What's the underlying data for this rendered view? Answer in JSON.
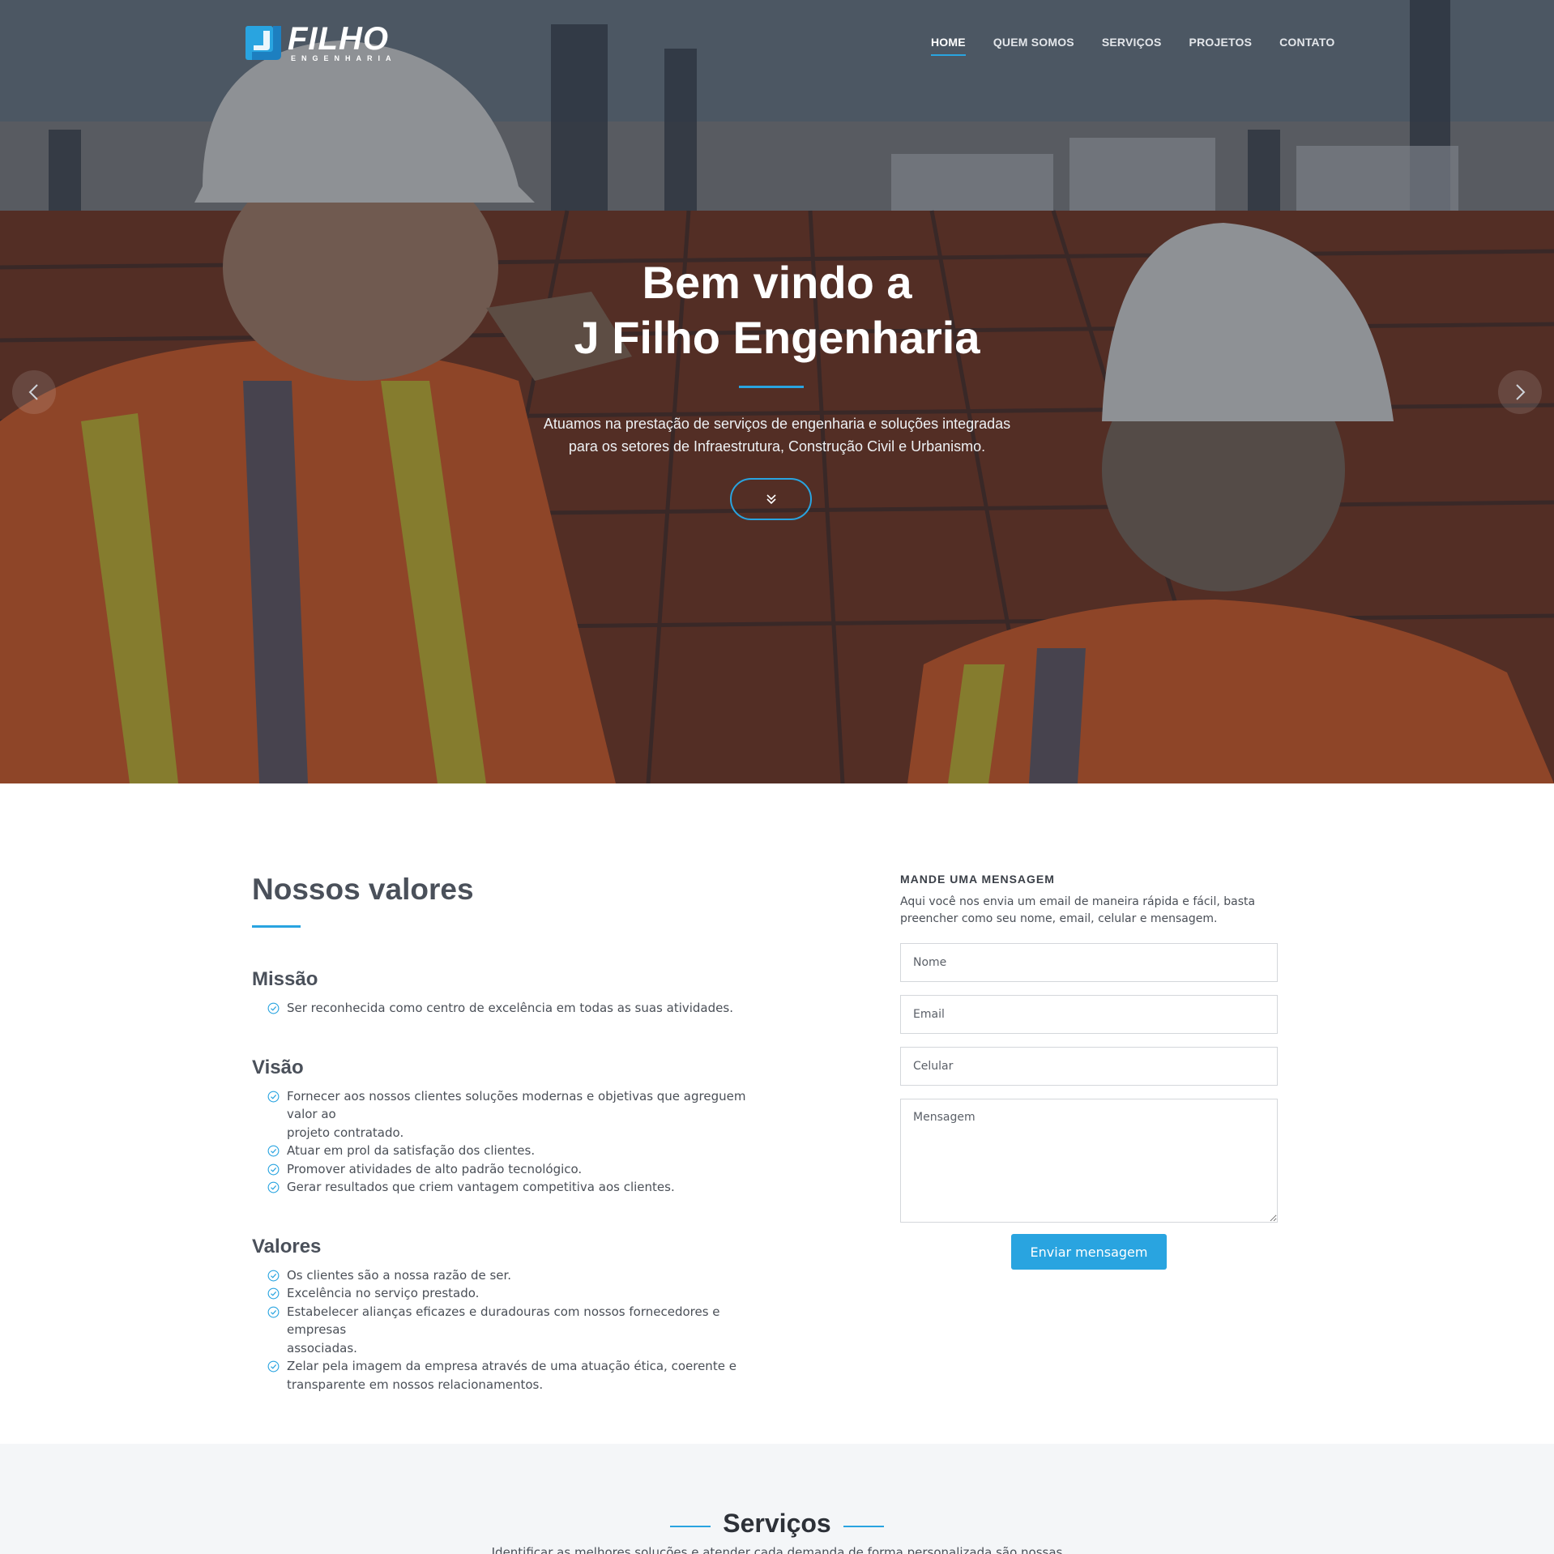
{
  "brand": {
    "logo_word": "FILHO",
    "logo_sub": "ENGENHARIA",
    "accent_color": "#29a4e0"
  },
  "nav": {
    "items": [
      {
        "label": "HOME",
        "active": true
      },
      {
        "label": "QUEM SOMOS",
        "active": false
      },
      {
        "label": "SERVIÇOS",
        "active": false
      },
      {
        "label": "PROJETOS",
        "active": false
      },
      {
        "label": "CONTATO",
        "active": false
      }
    ]
  },
  "hero": {
    "title_line1": "Bem vindo a",
    "title_line2": "J Filho Engenharia",
    "subtitle_line1": "Atuamos na prestação de serviços de engenharia e soluções integradas",
    "subtitle_line2": "para os setores de Infraestrutura, Construção Civil e Urbanismo.",
    "scroll_icon": "chevron-double-down-icon",
    "prev_icon": "chevron-left-icon",
    "next_icon": "chevron-right-icon"
  },
  "values": {
    "title": "Nossos valores",
    "groups": [
      {
        "title": "Missão",
        "items": [
          [
            "Ser reconhecida como centro de excelência em todas as suas atividades."
          ]
        ]
      },
      {
        "title": "Visão",
        "items": [
          [
            "Fornecer aos nossos clientes soluções modernas e objetivas que agreguem valor ao",
            "projeto contratado."
          ],
          [
            "Atuar em prol da satisfação dos clientes."
          ],
          [
            "Promover atividades de alto padrão tecnológico."
          ],
          [
            "Gerar resultados que criem vantagem competitiva aos clientes."
          ]
        ]
      },
      {
        "title": "Valores",
        "items": [
          [
            "Os clientes são a nossa razão de ser."
          ],
          [
            "Excelência no serviço prestado."
          ],
          [
            "Estabelecer alianças eficazes e duradouras com nossos fornecedores e empresas",
            "associadas."
          ],
          [
            "Zelar pela imagem da empresa através de uma atuação ética, coerente e",
            "transparente em nossos relacionamentos."
          ]
        ]
      }
    ]
  },
  "contact_form": {
    "title": "MANDE UMA MENSAGEM",
    "desc_line1": "Aqui você nos envia um email de maneira rápida e fácil, basta",
    "desc_line2": "preencher como seu nome, email, celular e mensagem.",
    "name_placeholder": "Nome",
    "email_placeholder": "Email",
    "phone_placeholder": "Celular",
    "message_placeholder": "Mensagem",
    "submit_label": "Enviar mensagem"
  },
  "services": {
    "title": "Serviços",
    "subtitle": "Identificar as melhores soluções e atender cada demanda de forma personalizada são nossas"
  }
}
